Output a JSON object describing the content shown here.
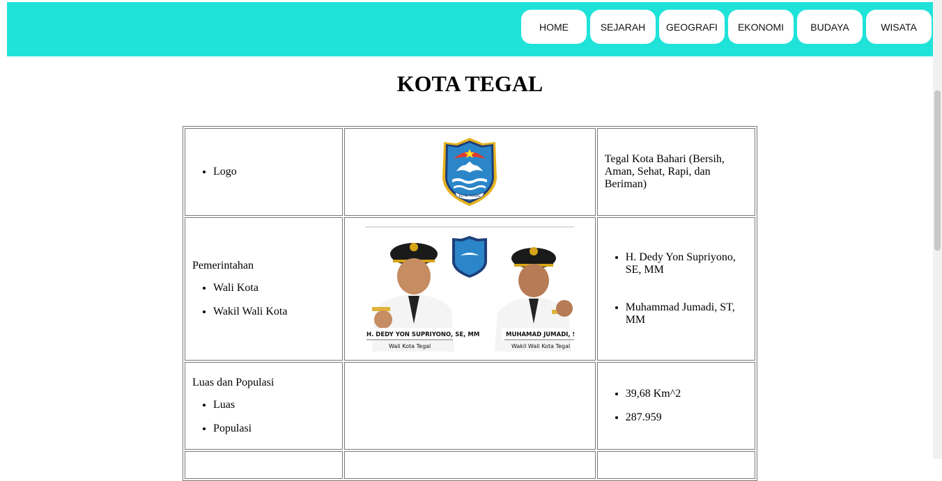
{
  "nav": {
    "items": [
      {
        "label": "HOME"
      },
      {
        "label": "SEJARAH"
      },
      {
        "label": "GEOGRAFI"
      },
      {
        "label": "EKONOMI"
      },
      {
        "label": "BUDAYA"
      },
      {
        "label": "WISATA"
      }
    ]
  },
  "title": "KOTA TEGAL",
  "rows": {
    "logo": {
      "label": "Logo",
      "emblem_text": "KOTA TEGAL",
      "motto": "Tegal Kota Bahari (Bersih, Aman, Sehat, Rapi, dan Beriman)"
    },
    "government": {
      "heading": "Pemerintahan",
      "items": [
        "Wali Kota",
        "Wakil Wali Kota"
      ],
      "values": [
        "H. Dedy Yon Supriyono, SE, MM",
        "Muhammad Jumadi, ST, MM"
      ],
      "photo": {
        "left_name": "H. DEDY YON SUPRIYONO, SE, MM",
        "left_role": "Wali Kota Tegal",
        "right_name": "MUHAMAD JUMADI, ST, MM",
        "right_role": "Wakil Wali Kota Tegal"
      }
    },
    "area": {
      "heading": "Luas dan Populasi",
      "items": [
        "Luas",
        "Populasi"
      ],
      "values": [
        "39,68 Km^2",
        "287.959"
      ]
    }
  },
  "colors": {
    "navbar": "#1fe3d9",
    "nav_button": "#ffffff",
    "shield_blue": "#2b86c9",
    "shield_gold": "#e6b21e"
  }
}
